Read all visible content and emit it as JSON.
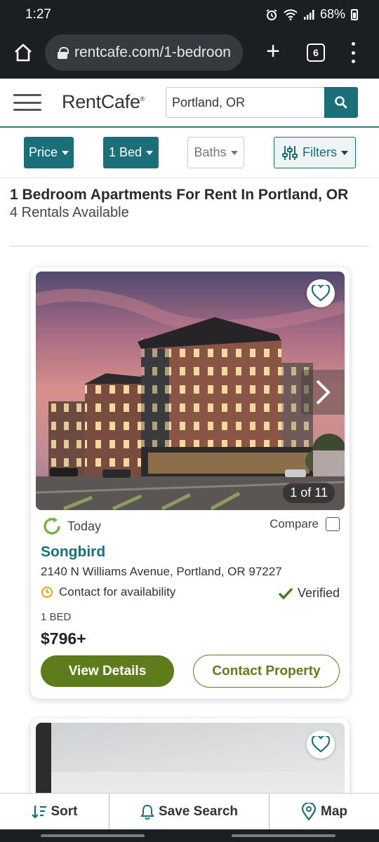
{
  "status": {
    "time": "1:27",
    "battery": "68%"
  },
  "browser": {
    "url": "rentcafe.com/1-bedroon",
    "tab_count": "6"
  },
  "site": {
    "logo": "RentCafe",
    "search_value": "Portland, OR"
  },
  "filters": {
    "price": "Price",
    "beds": "1 Bed",
    "baths": "Baths",
    "filters": "Filters"
  },
  "heading": {
    "title": "1 Bedroom Apartments For Rent In Portland, OR",
    "count": "4 Rentals Available"
  },
  "listing": {
    "photo_counter": "1 of 11",
    "updated": "Today",
    "compare": "Compare",
    "name": "Songbird",
    "address": "2140 N Williams Avenue, Portland, OR 97227",
    "availability": "Contact for availability",
    "verified": "Verified",
    "beds": "1 BED",
    "price": "$796+",
    "details_button": "View Details",
    "contact_button": "Contact Property"
  },
  "bottom_bar": {
    "sort": "Sort",
    "save_search": "Save Search",
    "map": "Map"
  },
  "colors": {
    "teal": "#1a6f78",
    "olive": "#5e7c1c",
    "chrome": "#1c1f22"
  }
}
